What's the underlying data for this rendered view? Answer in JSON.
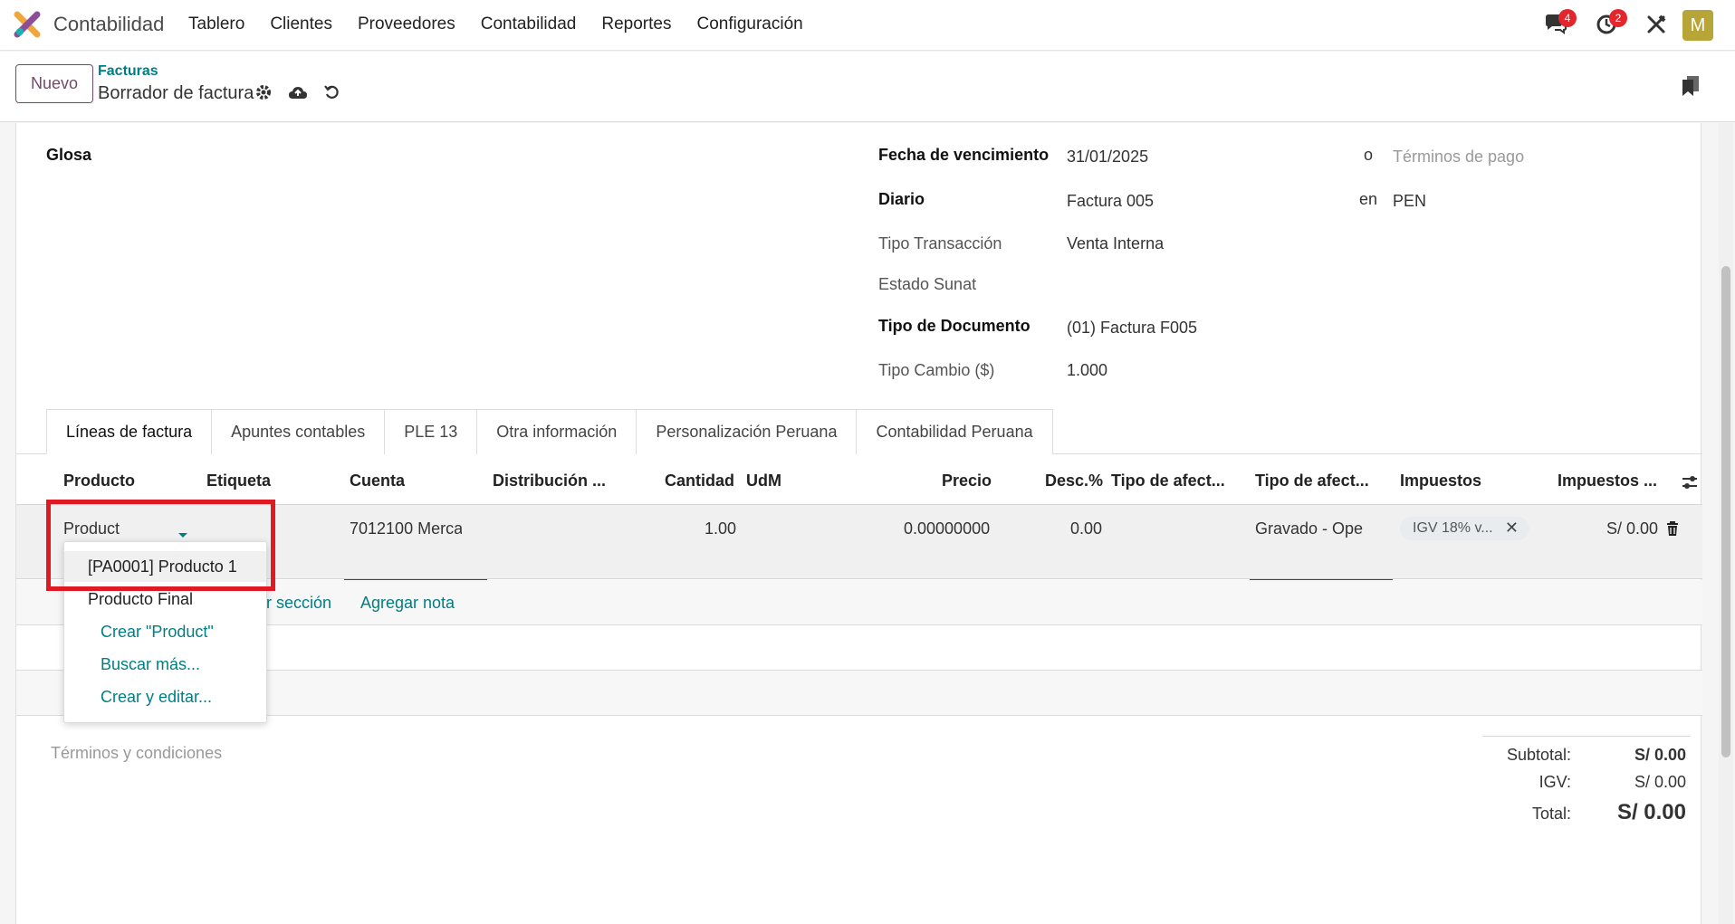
{
  "app": {
    "name": "Contabilidad"
  },
  "menu": [
    "Tablero",
    "Clientes",
    "Proveedores",
    "Contabilidad",
    "Reportes",
    "Configuración"
  ],
  "systray": {
    "messages_count": "4",
    "activities_count": "2",
    "avatar_letter": "M"
  },
  "control": {
    "new_label": "Nuevo",
    "breadcrumb_parent": "Facturas",
    "breadcrumb_current": "Borrador de factura"
  },
  "form": {
    "glosa_label": "Glosa",
    "fecha_venc_label": "Fecha de vencimiento",
    "fecha_venc_value": "31/01/2025",
    "or_label": "o",
    "terminos_pago_placeholder": "Términos de pago",
    "diario_label": "Diario",
    "diario_value": "Factura 005",
    "en_label": "en",
    "currency_value": "PEN",
    "tipo_trans_label": "Tipo Transacción",
    "tipo_trans_value": "Venta Interna",
    "estado_sunat_label": "Estado Sunat",
    "tipo_doc_label": "Tipo de Documento",
    "tipo_doc_value": "(01) Factura F005",
    "tipo_cambio_label": "Tipo Cambio ($)",
    "tipo_cambio_value": "1.000"
  },
  "tabs": [
    "Líneas de factura",
    "Apuntes contables",
    "PLE 13",
    "Otra información",
    "Personalización Peruana",
    "Contabilidad Peruana"
  ],
  "table": {
    "headers": [
      "Producto",
      "Etiqueta",
      "Cuenta",
      "Distribución ...",
      "Cantidad",
      "UdM",
      "Precio",
      "Desc.%",
      "Tipo de afect...",
      "Tipo de afect...",
      "Impuestos",
      "Impuestos ..."
    ],
    "row": {
      "producto": "Product",
      "cuenta": "7012100 Merca",
      "cantidad": "1.00",
      "precio": "0.00000000",
      "desc": "0.00",
      "tipo_afect": "Gravado - Ope",
      "impuesto_tag": "IGV 18% v...",
      "impuesto_total": "S/ 0.00"
    },
    "add_section_partial": "ar sección",
    "add_note": "Agregar nota"
  },
  "dropdown": {
    "items": [
      "[PA0001] Producto 1",
      "Producto Final"
    ],
    "actions": [
      "Crear \"Product\"",
      "Buscar más...",
      "Crear y editar..."
    ]
  },
  "terms_placeholder": "Términos y condiciones",
  "totals": {
    "subtotal_label": "Subtotal:",
    "subtotal_value": "S/ 0.00",
    "igv_label": "IGV:",
    "igv_value": "S/ 0.00",
    "total_label": "Total:",
    "total_value": "S/ 0.00"
  },
  "colors": {
    "brand": "#714b67",
    "link": "#017e84",
    "highlight_box": "#e01a22",
    "badge": "#e3262b",
    "avatar": "#b8a538"
  }
}
